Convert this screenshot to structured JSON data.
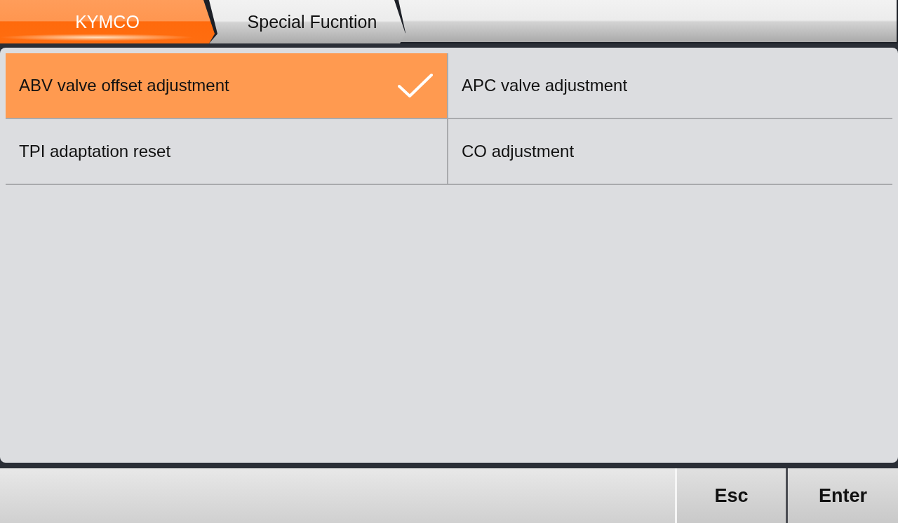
{
  "breadcrumbs": [
    {
      "label": "KYMCO",
      "selected": true
    },
    {
      "label": "Special Fucntion",
      "selected": false
    }
  ],
  "functions": [
    {
      "label": "ABV valve offset adjustment",
      "selected": true
    },
    {
      "label": "APC valve adjustment",
      "selected": false
    },
    {
      "label": "TPI adaptation reset",
      "selected": false
    },
    {
      "label": "CO adjustment",
      "selected": false
    }
  ],
  "buttons": [
    "Esc",
    "Enter"
  ]
}
